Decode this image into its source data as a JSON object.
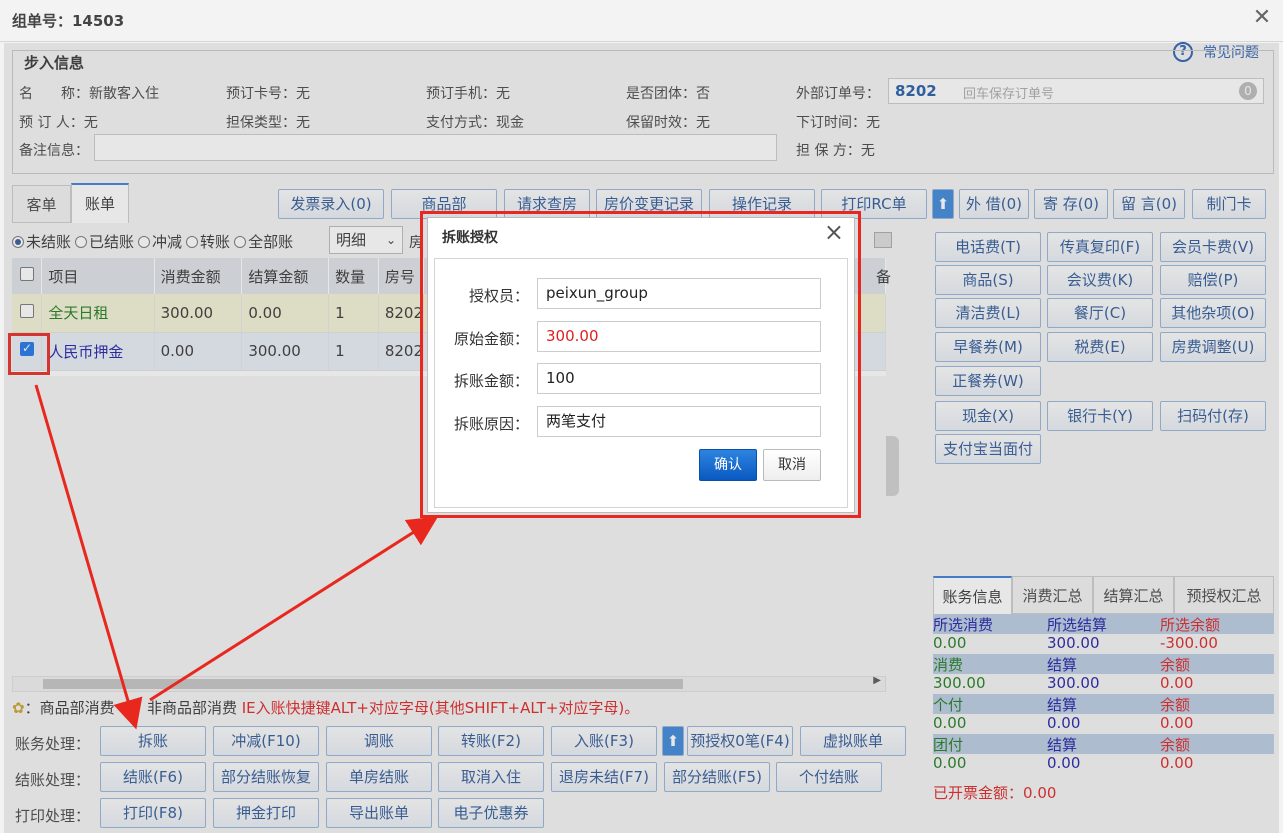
{
  "header": {
    "title": "组单号：14503"
  },
  "help": {
    "label": "常见问题"
  },
  "info": {
    "legend": "步入信息",
    "name_label": "名　　称：",
    "name_value": "新散客入住",
    "card_label": "预订卡号：",
    "card_value": "无",
    "phone_label": "预订手机：",
    "phone_value": "无",
    "group_label": "是否团体：",
    "group_value": "否",
    "ext_label": "外部订单号：",
    "ext_value": "8202",
    "ext_placeholder": "回车保存订单号",
    "ext_badge": "0",
    "booker_label": "预 订 人：",
    "booker_value": "无",
    "guarantee_type_label": "担保类型：",
    "guarantee_type_value": "无",
    "pay_label": "支付方式：",
    "pay_value": "现金",
    "retain_label": "保留时效：",
    "retain_value": "无",
    "order_time_label": "下订时间：",
    "order_time_value": "无",
    "remark_label": "备注信息：",
    "guarantor_label": "担 保 方：",
    "guarantor_value": "无"
  },
  "tabs": [
    "客单",
    "账单"
  ],
  "toolbar": [
    "发票录入(0)",
    "商品部",
    "请求查房",
    "房价变更记录",
    "操作记录",
    "打印RC单"
  ],
  "toolbar_right": [
    "外 借(0)",
    "寄 存(0)",
    "留 言(0)",
    "制门卡"
  ],
  "filters": {
    "radios": [
      "未结账",
      "已结账",
      "冲减",
      "转账",
      "全部账"
    ],
    "select": "明细",
    "extra": "房"
  },
  "table": {
    "headers": [
      "项目",
      "消费金额",
      "结算金额",
      "数量",
      "房号"
    ],
    "rows": [
      {
        "item": "全天日租",
        "consume": "300.00",
        "settle": "0.00",
        "qty": "1",
        "room": "8202"
      },
      {
        "item": "人民币押金",
        "consume": "0.00",
        "settle": "300.00",
        "qty": "1",
        "room": "8202"
      }
    ],
    "trailing_header": "备"
  },
  "charge_buttons": [
    [
      "电话费(T)",
      "传真复印(F)",
      "会员卡费(V)"
    ],
    [
      "商品(S)",
      "会议费(K)",
      "赔偿(P)"
    ],
    [
      "清洁费(L)",
      "餐厅(C)",
      "其他杂项(O)"
    ],
    [
      "早餐券(M)",
      "税费(E)",
      "房费调整(U)"
    ],
    [
      "正餐券(W)"
    ]
  ],
  "pay_buttons": [
    [
      "现金(X)",
      "银行卡(Y)",
      "扫码付(存)"
    ],
    [
      "支付宝当面付"
    ]
  ],
  "summary": {
    "tabs": [
      "账务信息",
      "消费汇总",
      "结算汇总",
      "预授权汇总"
    ],
    "blocks": [
      {
        "h": [
          "所选消费",
          "所选结算",
          "所选余额"
        ],
        "v": [
          "0.00",
          "300.00",
          "-300.00"
        ]
      },
      {
        "h": [
          "消费",
          "结算",
          "余额"
        ],
        "v": [
          "300.00",
          "300.00",
          "0.00"
        ]
      },
      {
        "h": [
          "个付",
          "结算",
          "余额"
        ],
        "v": [
          "0.00",
          "0.00",
          "0.00"
        ]
      },
      {
        "h": [
          "团付",
          "结算",
          "余额"
        ],
        "v": [
          "0.00",
          "0.00",
          "0.00"
        ]
      }
    ],
    "invoice_label": "已开票金额：",
    "invoice_value": "0.00"
  },
  "legend_line": {
    "a": "：商品部消费",
    "b": "：非商品部消费",
    "hint": "IE入账快捷键ALT+对应字母(其他SHIFT+ALT+对应字母)。"
  },
  "actions": {
    "row1_label": "账务处理：",
    "row1": [
      "拆账",
      "冲减(F10)",
      "调账",
      "转账(F2)",
      "入账(F3)",
      "预授权0笔(F4)",
      "虚拟账单"
    ],
    "row2_label": "结账处理：",
    "row2": [
      "结账(F6)",
      "部分结账恢复",
      "单房结账",
      "取消入住",
      "退房未结(F7)",
      "部分结账(F5)",
      "个付结账"
    ],
    "row3_label": "打印处理：",
    "row3": [
      "打印(F8)",
      "押金打印",
      "导出账单",
      "电子优惠券"
    ]
  },
  "dialog": {
    "title": "拆账授权",
    "auth_label": "授权员：",
    "auth_value": "peixun_group",
    "orig_label": "原始金额：",
    "orig_value": "300.00",
    "split_label": "拆账金额：",
    "split_value": "100",
    "reason_label": "拆账原因：",
    "reason_value": "两笔支付",
    "ok": "确认",
    "cancel": "取消"
  },
  "colors": {
    "accent": "#2b5797",
    "highlight": "#e8281e",
    "row_yellow": "#f3f2d6",
    "row_blue": "#e8eef7"
  }
}
